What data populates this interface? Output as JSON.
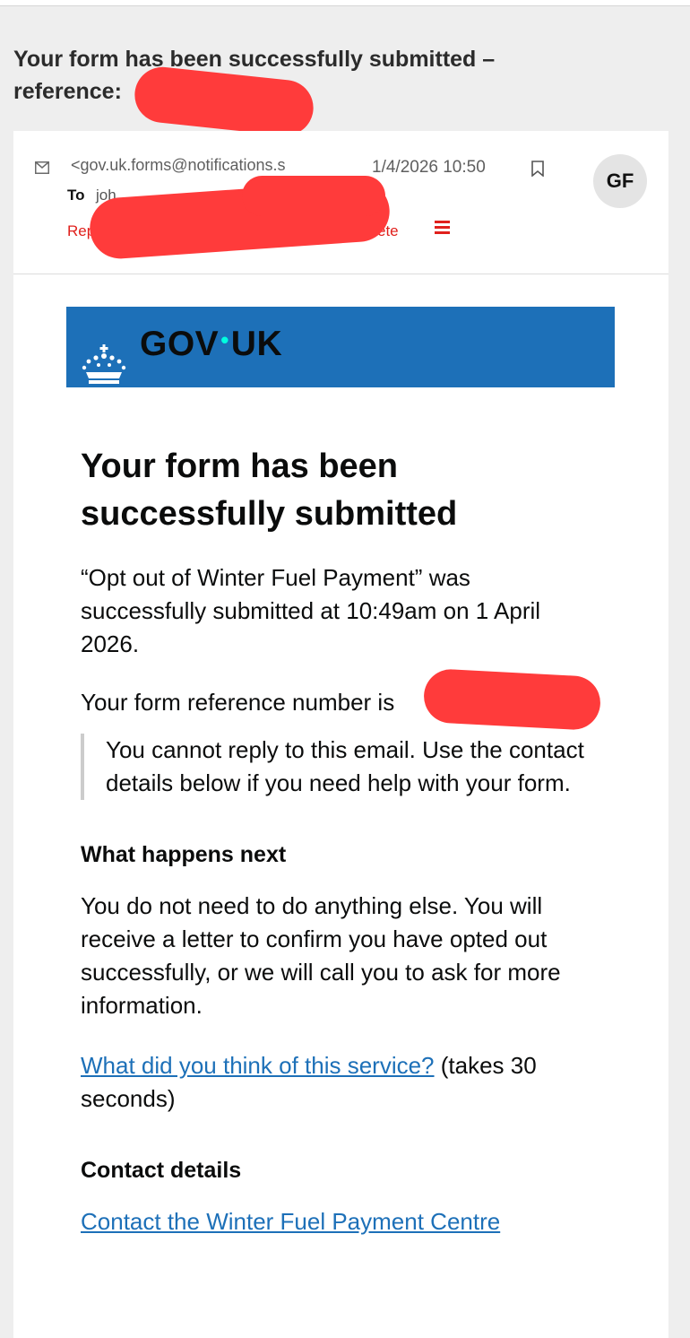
{
  "email": {
    "subject_line1": "Your form has been successfully submitted –",
    "subject_line2": "reference: ",
    "header": {
      "from": "<gov.uk.forms@notifications.s",
      "date": "1/4/2026 10:50",
      "avatar_initials": "GF",
      "to_label": "To",
      "to_value": "joh",
      "action_left": "Rep",
      "action_right": "ete"
    }
  },
  "banner": {
    "logo_left": "GOV",
    "logo_dot": "•",
    "logo_right": "UK",
    "color": "#1d70b8"
  },
  "body": {
    "heading": "Your form has been successfully submitted",
    "intro": "“Opt out of Winter Fuel Payment” was successfully submitted at 10:49am on 1 April 2026.",
    "reference_text": "Your form reference number is ",
    "reference_value": "",
    "inset_text": "You cannot reply to this email. Use the contact details below if you need help with your form.",
    "next_heading": "What happens next",
    "next_text": "You do not need to do anything else. You will receive a letter to confirm you have opted out successfully, or we will call you to ask for more information.",
    "feedback_link": "What did you think of this service?",
    "feedback_suffix": " (takes 30 seconds)",
    "contact_heading": "Contact details",
    "contact_link": "Contact the Winter Fuel Payment Centre"
  },
  "colors": {
    "redaction": "#ff3b3b",
    "accent_red": "#e0201c",
    "link": "#1d70b8"
  }
}
